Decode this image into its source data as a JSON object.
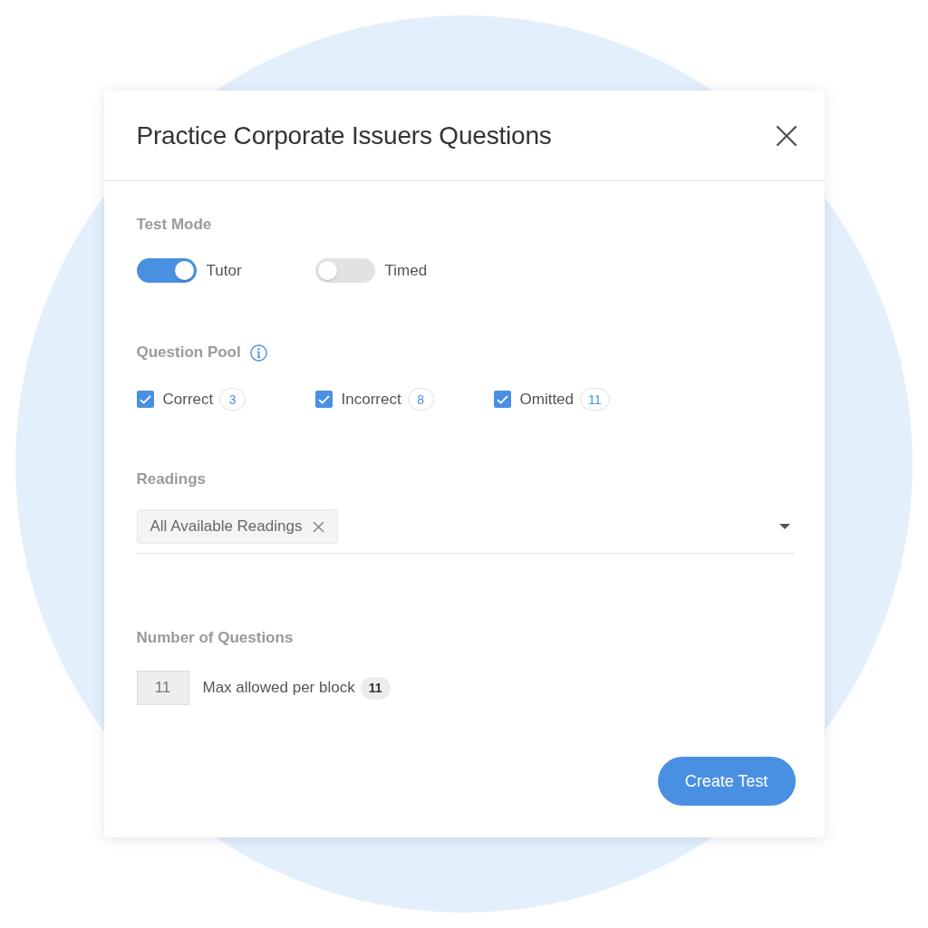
{
  "dialog": {
    "title": "Practice Corporate Issuers Questions"
  },
  "test_mode": {
    "label": "Test Mode",
    "options": [
      {
        "label": "Tutor",
        "on": true
      },
      {
        "label": "Timed",
        "on": false
      }
    ]
  },
  "question_pool": {
    "label": "Question Pool",
    "options": [
      {
        "label": "Correct",
        "checked": true,
        "count": "3"
      },
      {
        "label": "Incorrect",
        "checked": true,
        "count": "8"
      },
      {
        "label": "Omitted",
        "checked": true,
        "count": "11"
      }
    ]
  },
  "readings": {
    "label": "Readings",
    "chips": [
      {
        "label": "All Available Readings"
      }
    ]
  },
  "number_of_questions": {
    "label": "Number of Questions",
    "value": "11",
    "max_label": "Max allowed per block",
    "max_count": "11"
  },
  "buttons": [
    {
      "label": "Create Test"
    }
  ]
}
